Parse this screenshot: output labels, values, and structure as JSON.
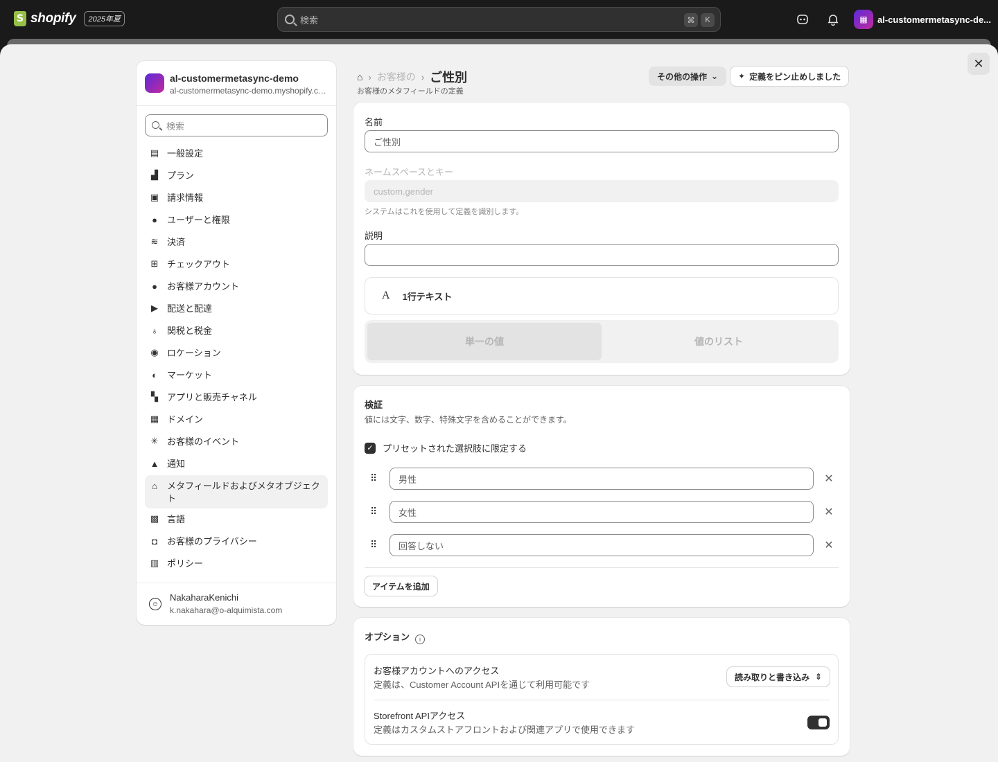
{
  "topbar": {
    "brand": "shopify",
    "edition": "2025年夏",
    "search_placeholder": "検索",
    "shortcut_cmd": "⌘",
    "shortcut_key": "K",
    "store_name": "al-customermetasync-de..."
  },
  "sidebar": {
    "store_name": "al-customermetasync-demo",
    "store_domain": "al-customermetasync-demo.myshopify.com",
    "search_placeholder": "検索",
    "items": [
      {
        "label": "一般設定",
        "icon": "store-icon"
      },
      {
        "label": "プラン",
        "icon": "plan-icon"
      },
      {
        "label": "請求情報",
        "icon": "receipt-icon"
      },
      {
        "label": "ユーザーと権限",
        "icon": "users-icon"
      },
      {
        "label": "決済",
        "icon": "payment-icon"
      },
      {
        "label": "チェックアウト",
        "icon": "cart-icon"
      },
      {
        "label": "お客様アカウント",
        "icon": "person-icon"
      },
      {
        "label": "配送と配達",
        "icon": "truck-icon"
      },
      {
        "label": "関税と税金",
        "icon": "tax-icon"
      },
      {
        "label": "ロケーション",
        "icon": "location-icon"
      },
      {
        "label": "マーケット",
        "icon": "globe-icon"
      },
      {
        "label": "アプリと販売チャネル",
        "icon": "apps-icon"
      },
      {
        "label": "ドメイン",
        "icon": "domain-icon"
      },
      {
        "label": "お客様のイベント",
        "icon": "cursor-icon"
      },
      {
        "label": "通知",
        "icon": "bell-icon"
      },
      {
        "label": "メタフィールドおよびメタオブジェクト",
        "icon": "metafield-icon"
      },
      {
        "label": "言語",
        "icon": "language-icon"
      },
      {
        "label": "お客様のプライバシー",
        "icon": "lock-icon"
      },
      {
        "label": "ポリシー",
        "icon": "policy-icon"
      }
    ],
    "user_name": "NakaharaKenichi",
    "user_email": "k.nakahara@o-alquimista.com"
  },
  "header": {
    "breadcrumb_mid": "お客様の",
    "title": "ご性別",
    "subtitle": "お客様のメタフィールドの定義",
    "more_actions": "その他の操作",
    "pin_label": "定義をピン止めしました"
  },
  "definition": {
    "name_label": "名前",
    "name_value": "ご性別",
    "namespace_label": "ネームスペースとキー",
    "namespace_value": "custom.gender",
    "namespace_help": "システムはこれを使用して定義を識別します。",
    "description_label": "説明",
    "description_value": "",
    "type_label": "1行テキスト",
    "type_glyph": "A",
    "value_single": "単一の値",
    "value_list": "値のリスト"
  },
  "validation": {
    "title": "検証",
    "description": "値には文字、数字、特殊文字を含めることができます。",
    "preset_label": "プリセットされた選択肢に限定する",
    "preset_checked": true,
    "choices": [
      "男性",
      "女性",
      "回答しない"
    ],
    "add_item": "アイテムを追加"
  },
  "options": {
    "title": "オプション",
    "customer_access_title": "お客様アカウントへのアクセス",
    "customer_access_desc": "定義は、Customer Account APIを通じて利用可能です",
    "customer_access_value": "読み取りと書き込み",
    "storefront_title": "Storefront APIアクセス",
    "storefront_desc": "定義はカスタムストアフロントおよび関連アプリで使用できます",
    "storefront_enabled": true
  }
}
